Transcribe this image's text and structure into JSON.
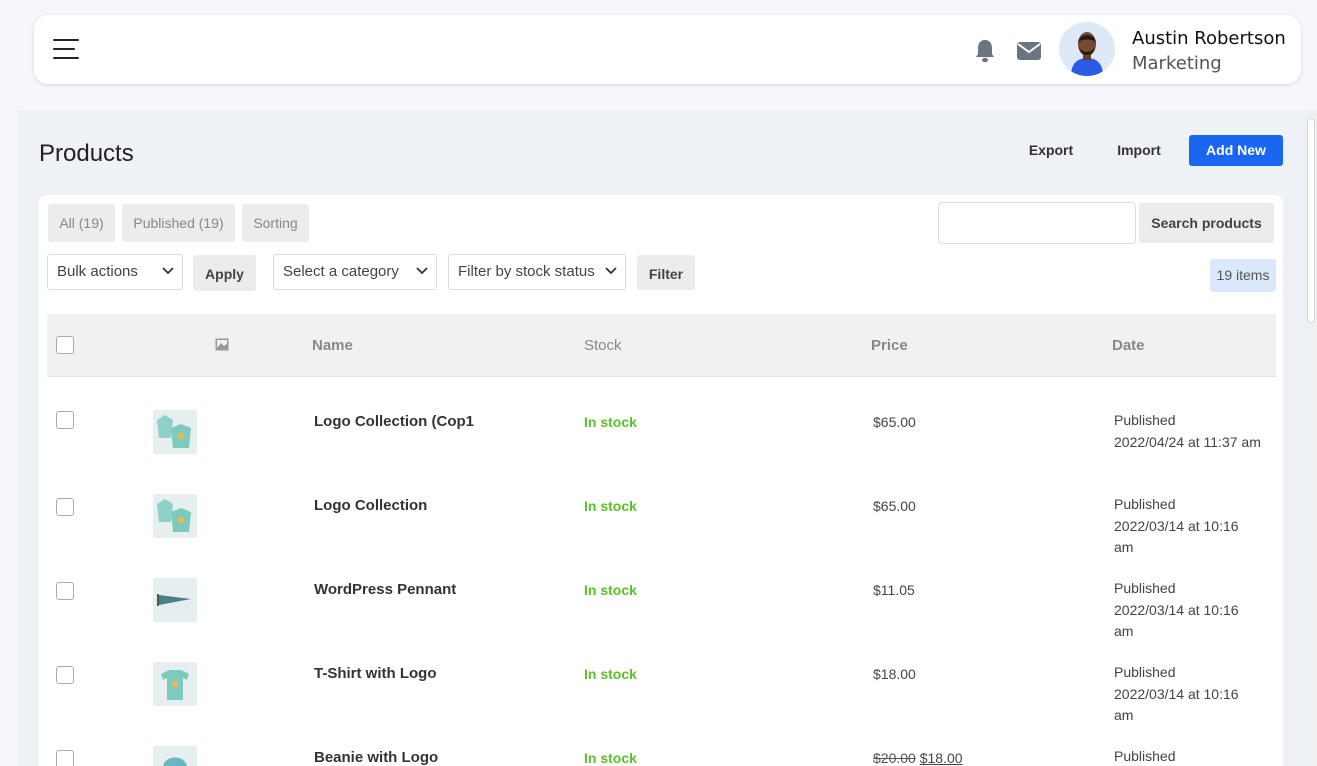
{
  "header": {
    "menu_icon": "hamburger-menu-icon",
    "notification_icon": "bell-icon",
    "messages_icon": "envelope-icon",
    "user": {
      "name": "Austin Robertson",
      "role": "Marketing"
    }
  },
  "page": {
    "title": "Products",
    "actions": {
      "export": "Export",
      "import": "Import",
      "add_new": "Add New"
    },
    "accent_color": "#1a66f0"
  },
  "tabs": [
    "All (19)",
    "Published (19)",
    "Sorting"
  ],
  "search": {
    "value": "",
    "placeholder": "",
    "button": "Search products"
  },
  "filters": {
    "bulk_actions": "Bulk actions",
    "apply": "Apply",
    "category": "Select a category",
    "stock_status": "Filter by stock status",
    "filter": "Filter",
    "items_count": "19 items"
  },
  "table": {
    "columns": [
      "Name",
      "Stock",
      "Price",
      "Date"
    ],
    "image_column_icon": "image-icon",
    "rows": [
      {
        "name": "Logo Collection (Cop1",
        "stock": "In stock",
        "price": "$65.00",
        "price_old": "",
        "date_status": "Published",
        "date_lines": [
          "2022/04/24 at 11:37 am"
        ],
        "thumb": "hoodie-shirt-collection-thumbnail"
      },
      {
        "name": "Logo Collection",
        "stock": "In stock",
        "price": "$65.00",
        "price_old": "",
        "date_status": "Published",
        "date_lines": [
          "2022/03/14 at 10:16",
          "am"
        ],
        "thumb": "hoodie-shirt-collection-thumbnail"
      },
      {
        "name": "WordPress Pennant",
        "stock": "In stock",
        "price": "$11.05",
        "price_old": "",
        "date_status": "Published",
        "date_lines": [
          "2022/03/14 at 10:16",
          "am"
        ],
        "thumb": "pennant-thumbnail"
      },
      {
        "name": "T-Shirt with Logo",
        "stock": "In stock",
        "price": "$18.00",
        "price_old": "",
        "date_status": "Published",
        "date_lines": [
          "2022/03/14 at 10:16",
          "am"
        ],
        "thumb": "tshirt-thumbnail"
      },
      {
        "name": "Beanie with Logo",
        "stock": "In stock",
        "price": "$18.00",
        "price_old": "$20.00",
        "date_status": "Published",
        "date_lines": [],
        "thumb": "beanie-thumbnail"
      }
    ]
  },
  "colors": {
    "in_stock": "#5cbf2a",
    "count_badge_bg": "#dbe8fb"
  }
}
